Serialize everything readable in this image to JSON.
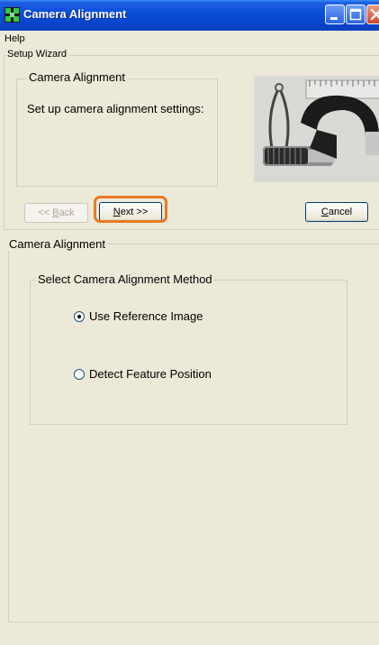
{
  "window": {
    "title": "Camera Alignment",
    "controls": {
      "minimize": "minimize-icon",
      "maximize": "maximize-icon",
      "close": "close-icon"
    }
  },
  "menu": {
    "items": [
      "Help"
    ]
  },
  "wizard": {
    "group_label": "Setup Wizard",
    "info": {
      "title": "Camera Alignment",
      "description": "Set up camera alignment settings:"
    },
    "buttons": {
      "back": {
        "label_prefix": "<< ",
        "mnemonic": "B",
        "label_rest": "ack"
      },
      "next": {
        "mnemonic": "N",
        "label_rest": "ext >>"
      },
      "cancel": {
        "mnemonic": "C",
        "label_rest": "ancel"
      }
    }
  },
  "alignment": {
    "group_label": "Camera Alignment",
    "method_group_label": "Select Camera Alignment Method",
    "options": [
      {
        "label": "Use Reference Image",
        "selected": true
      },
      {
        "label": "Detect Feature Position",
        "selected": false
      }
    ]
  },
  "colors": {
    "highlight": "#e97a22",
    "titlebar": "#0a4fd8"
  }
}
